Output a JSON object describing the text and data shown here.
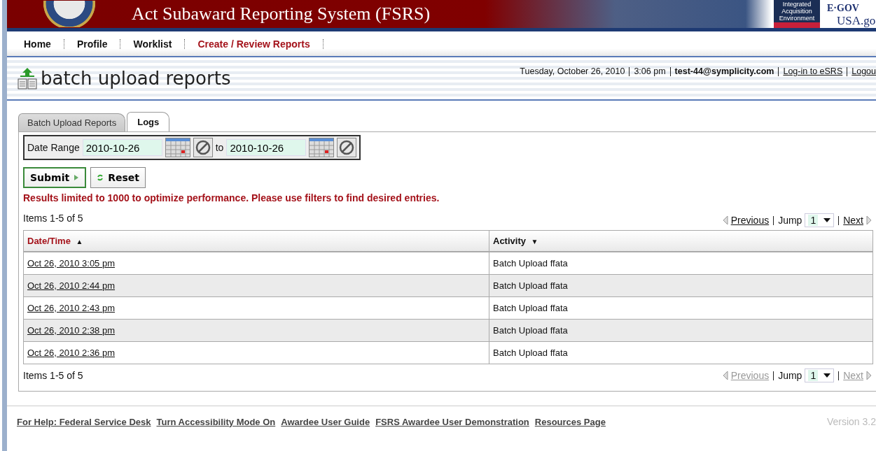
{
  "banner": {
    "title": "Act Subaward Reporting System (FSRS)",
    "partner_logo": "Integrated Acquisition Environment",
    "egov": "E·GOV",
    "usagov": "USA.go"
  },
  "nav": [
    {
      "label": "Home",
      "selected": false
    },
    {
      "label": "Profile",
      "selected": false
    },
    {
      "label": "Worklist",
      "selected": false
    },
    {
      "label": "Create / Review Reports",
      "selected": true
    }
  ],
  "page": {
    "title": "batch upload reports",
    "date": "Tuesday, October 26, 2010",
    "time": "3:06 pm",
    "user": "test-44@symplicity.com",
    "links": [
      "Log-in to eSRS",
      "Logou"
    ]
  },
  "tabs": [
    {
      "label": "Batch Upload Reports",
      "selected": false
    },
    {
      "label": "Logs",
      "selected": true
    }
  ],
  "date_range": {
    "label": "Date Range",
    "from": "2010-10-26",
    "to_label": "to",
    "to": "2010-10-26"
  },
  "buttons": {
    "submit": "Submit",
    "reset": "Reset"
  },
  "notice": "Results limited to 1000 to optimize performance. Please use filters to find desired entries.",
  "pagers": [
    {
      "summary": "Items 1-5 of 5",
      "previous": "Previous",
      "previous_disabled": false,
      "jump_label": "Jump",
      "jump_value": "1",
      "next": "Next",
      "next_disabled": false
    },
    {
      "summary": "Items 1-5 of 5",
      "previous": "Previous",
      "previous_disabled": true,
      "jump_label": "Jump",
      "jump_value": "1",
      "next": "Next",
      "next_disabled": true
    }
  ],
  "table": {
    "columns": [
      {
        "label": "Date/Time",
        "sorted": true,
        "arrow": "▲"
      },
      {
        "label": "Activity",
        "sorted": false,
        "arrow": "▼"
      }
    ],
    "rows": [
      {
        "cells": [
          "Oct 26, 2010 3:05 pm",
          "Batch Upload ffata"
        ]
      },
      {
        "cells": [
          "Oct 26, 2010 2:44 pm",
          "Batch Upload ffata"
        ]
      },
      {
        "cells": [
          "Oct 26, 2010 2:43 pm",
          "Batch Upload ffata"
        ]
      },
      {
        "cells": [
          "Oct 26, 2010 2:38 pm",
          "Batch Upload ffata"
        ]
      },
      {
        "cells": [
          "Oct 26, 2010 2:36 pm",
          "Batch Upload ffata"
        ]
      }
    ]
  },
  "footer": {
    "links": [
      "For Help: Federal Service Desk",
      "Turn Accessibility Mode On",
      "Awardee User Guide",
      "FSRS Awardee User Demonstration",
      "Resources Page"
    ],
    "version": "Version 3.2"
  }
}
